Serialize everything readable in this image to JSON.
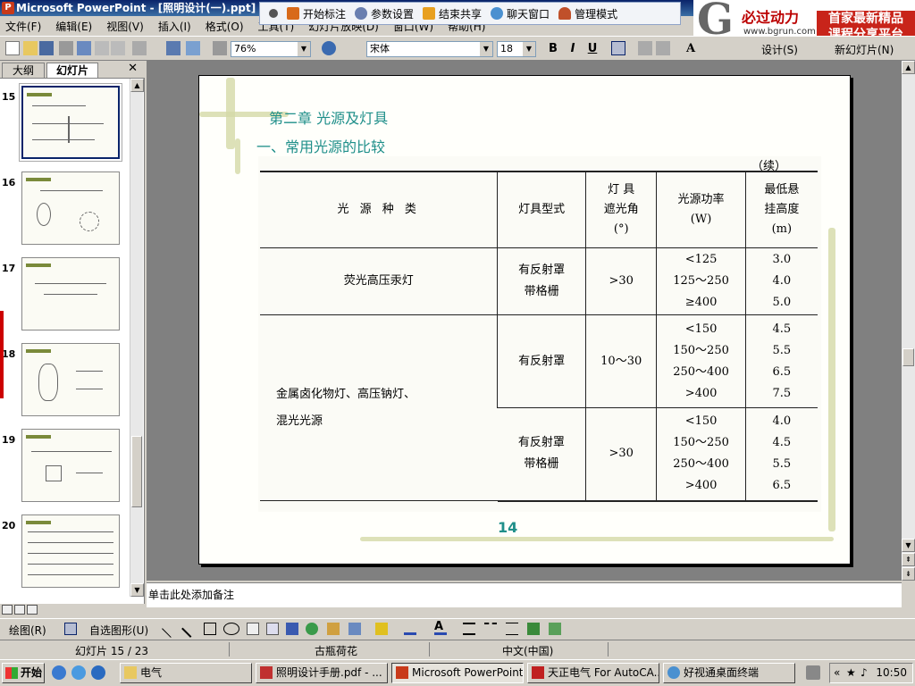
{
  "window": {
    "title": "Microsoft PowerPoint - [照明设计(一).ppt]"
  },
  "sharebar": {
    "items": [
      "开始标注",
      "参数设置",
      "结束共享",
      "聊天窗口",
      "管理模式"
    ]
  },
  "logo": {
    "letter": "G",
    "brand": "必过动力",
    "url": "www.bgrun.com",
    "promo1": "首家最新精品",
    "promo2": "课程分享平台"
  },
  "menu": {
    "items": [
      "文件(F)",
      "编辑(E)",
      "视图(V)",
      "插入(I)",
      "格式(O)",
      "工具(T)",
      "幻灯片放映(D)",
      "窗口(W)",
      "帮助(H)"
    ]
  },
  "toolbar": {
    "zoom": "76%",
    "font": "宋体",
    "size": "18",
    "bold": "B",
    "italic": "I",
    "underline": "U",
    "design": "设计(S)",
    "new_slide": "新幻灯片(N)"
  },
  "leftpane": {
    "tab_outline": "大纲",
    "tab_slides": "幻灯片",
    "close": "✕",
    "slides": [
      {
        "num": "15"
      },
      {
        "num": "16"
      },
      {
        "num": "17"
      },
      {
        "num": "18"
      },
      {
        "num": "19"
      },
      {
        "num": "20"
      }
    ]
  },
  "slide": {
    "chapter": "第二章 光源及灯具",
    "section": "一、常用光源的比较",
    "continued": "（续）",
    "headers": {
      "type": "光 源 种 类",
      "fixture": "灯具型式",
      "angle": "灯  具\n遮光角\n(°)",
      "power": "光源功率\n(W)",
      "height": "最低悬\n挂高度\n(m)"
    },
    "rows": [
      {
        "type": "荧光高压汞灯",
        "fixture": "有反射罩\n带格栅",
        "angle": ">30",
        "power": "<125\n125～250\n≥400",
        "height": "3.0\n4.0\n5.0"
      },
      {
        "type": "金属卤化物灯、高压钠灯、\n混光光源",
        "fixture": "有反射罩",
        "angle": "10～30",
        "power": "<150\n150～250\n250～400\n>400",
        "height": "4.5\n5.5\n6.5\n7.5"
      },
      {
        "fixture": "有反射罩\n带格栅",
        "angle": ">30",
        "power": "<150\n150～250\n250～400\n>400",
        "height": "4.0\n4.5\n5.5\n6.5"
      }
    ],
    "page": "14"
  },
  "notes": {
    "placeholder": "单击此处添加备注"
  },
  "drawbar": {
    "draw": "绘图(R)",
    "autoshapes": "自选图形(U)"
  },
  "status": {
    "slide": "幻灯片 15 / 23",
    "design": "古瓶荷花",
    "lang": "中文(中国)"
  },
  "taskbar": {
    "start": "开始",
    "tasks": [
      "电气",
      "照明设计手册.pdf - ...",
      "Microsoft PowerPoint -...",
      "天正电气 For AutoCA...",
      "好视通桌面终端"
    ],
    "clock": "10:50"
  }
}
